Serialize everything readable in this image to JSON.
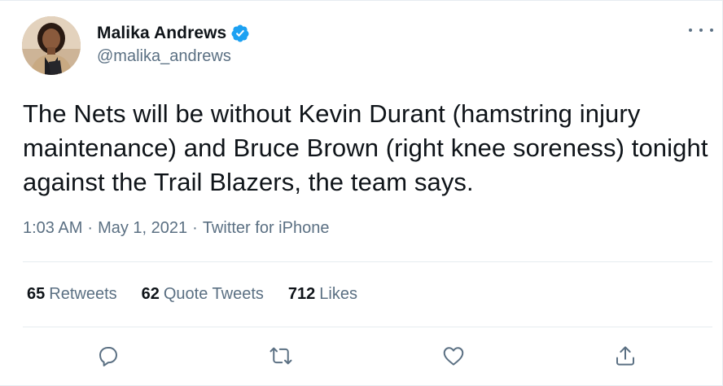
{
  "author": {
    "display_name": "Malika Andrews",
    "handle": "@malika_andrews",
    "verified": true,
    "avatar_icon": "profile-photo"
  },
  "tweet": {
    "text": "The Nets will be without Kevin Durant (hamstring injury maintenance) and Bruce Brown (right knee soreness) tonight against the Trail Blazers, the team says.",
    "time": "1:03 AM",
    "separator": "·",
    "date": "May 1, 2021",
    "source": "Twitter for iPhone"
  },
  "stats": {
    "retweets_count": "65",
    "retweets_label": "Retweets",
    "quotes_count": "62",
    "quotes_label": "Quote Tweets",
    "likes_count": "712",
    "likes_label": "Likes"
  },
  "actions": {
    "reply_icon": "reply-icon",
    "retweet_icon": "retweet-icon",
    "like_icon": "like-icon",
    "share_icon": "share-icon",
    "more_icon": "more-icon"
  },
  "colors": {
    "text_primary": "#0f1419",
    "text_secondary": "#5b7083",
    "verified_blue": "#1da1f2",
    "divider": "#e6ecf0"
  }
}
